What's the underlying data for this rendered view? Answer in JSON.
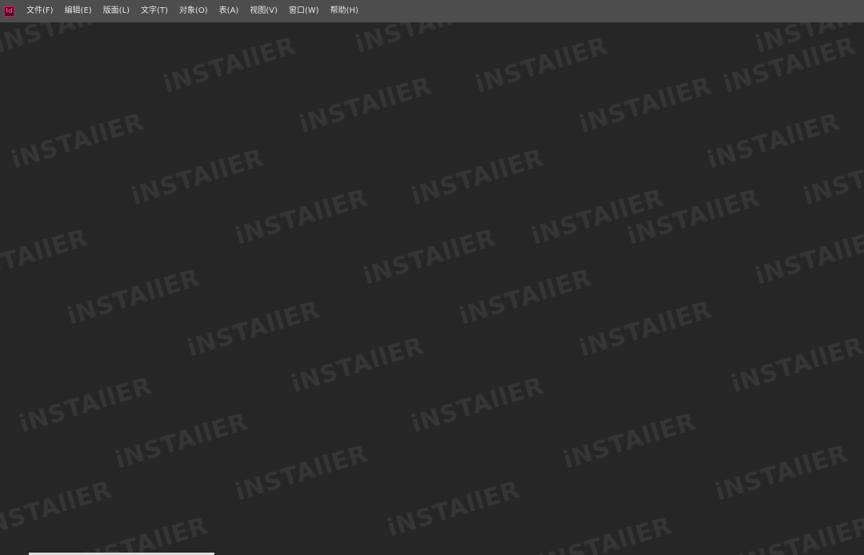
{
  "app": {
    "logo_text": "Id",
    "logo_icon": "indesign-logo-icon",
    "accent_color": "#d8175c"
  },
  "menu": {
    "items": [
      {
        "label": "文件(F)"
      },
      {
        "label": "编辑(E)"
      },
      {
        "label": "版面(L)"
      },
      {
        "label": "文字(T)"
      },
      {
        "label": "对象(O)"
      },
      {
        "label": "表(A)"
      },
      {
        "label": "视图(V)"
      },
      {
        "label": "窗口(W)"
      },
      {
        "label": "帮助(H)"
      }
    ]
  },
  "watermark": {
    "text": "iNSTAllER"
  }
}
